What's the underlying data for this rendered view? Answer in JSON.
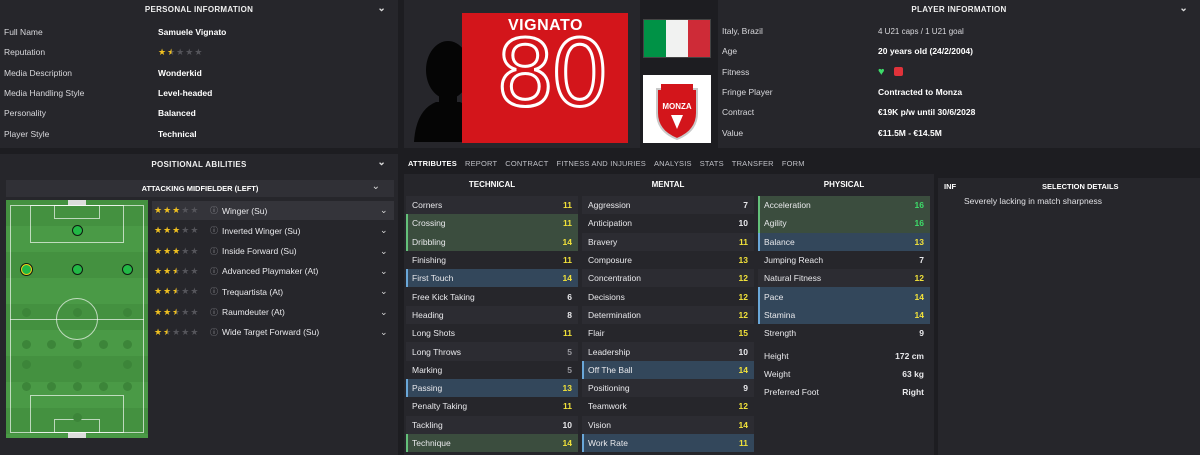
{
  "personal": {
    "title": "PERSONAL INFORMATION",
    "rows": [
      {
        "label": "Full Name",
        "value": "Samuele Vignato"
      },
      {
        "label": "Reputation",
        "value": ""
      },
      {
        "label": "Media Description",
        "value": "Wonderkid"
      },
      {
        "label": "Media Handling Style",
        "value": "Level-headed"
      },
      {
        "label": "Personality",
        "value": "Balanced"
      },
      {
        "label": "Player Style",
        "value": "Technical"
      }
    ],
    "reputation_stars": 1.5
  },
  "positional": {
    "title": "POSITIONAL ABILITIES",
    "sub_title": "ATTACKING MIDFIELDER (LEFT)",
    "roles": [
      {
        "name": "Winger (Su)",
        "stars": 3
      },
      {
        "name": "Inverted Winger (Su)",
        "stars": 3
      },
      {
        "name": "Inside Forward (Su)",
        "stars": 3
      },
      {
        "name": "Advanced Playmaker (At)",
        "stars": 2.5
      },
      {
        "name": "Trequartista (At)",
        "stars": 2.5
      },
      {
        "name": "Raumdeuter (At)",
        "stars": 2.5
      },
      {
        "name": "Wide Target Forward (Su)",
        "stars": 1.5
      }
    ]
  },
  "header": {
    "shirt_name": "VIGNATO",
    "shirt_number": "80",
    "club_badge": "MONZA"
  },
  "player_info": {
    "title": "PLAYER INFORMATION",
    "rows": [
      {
        "label": "Italy, Brazil",
        "value": "4 U21 caps / 1 U21 goal"
      },
      {
        "label": "Age",
        "value": "20 years old (24/2/2004)"
      },
      {
        "label": "Fitness",
        "value": ""
      },
      {
        "label": "Fringe Player",
        "value": "Contracted to Monza"
      },
      {
        "label": "Contract",
        "value": "€19K p/w until 30/6/2028"
      },
      {
        "label": "Value",
        "value": "€11.5M - €14.5M"
      }
    ]
  },
  "tabs": [
    "ATTRIBUTES",
    "REPORT",
    "CONTRACT",
    "FITNESS AND INJURIES",
    "ANALYSIS",
    "STATS",
    "TRANSFER",
    "FORM"
  ],
  "technical": {
    "title": "TECHNICAL",
    "rows": [
      {
        "name": "Corners",
        "value": "11"
      },
      {
        "name": "Crossing",
        "value": "11"
      },
      {
        "name": "Dribbling",
        "value": "14"
      },
      {
        "name": "Finishing",
        "value": "11"
      },
      {
        "name": "First Touch",
        "value": "14"
      },
      {
        "name": "Free Kick Taking",
        "value": "6"
      },
      {
        "name": "Heading",
        "value": "8"
      },
      {
        "name": "Long Shots",
        "value": "11"
      },
      {
        "name": "Long Throws",
        "value": "5"
      },
      {
        "name": "Marking",
        "value": "5"
      },
      {
        "name": "Passing",
        "value": "13"
      },
      {
        "name": "Penalty Taking",
        "value": "11"
      },
      {
        "name": "Tackling",
        "value": "10"
      },
      {
        "name": "Technique",
        "value": "14"
      }
    ]
  },
  "mental": {
    "title": "MENTAL",
    "rows": [
      {
        "name": "Aggression",
        "value": "7"
      },
      {
        "name": "Anticipation",
        "value": "10"
      },
      {
        "name": "Bravery",
        "value": "11"
      },
      {
        "name": "Composure",
        "value": "13"
      },
      {
        "name": "Concentration",
        "value": "12"
      },
      {
        "name": "Decisions",
        "value": "12"
      },
      {
        "name": "Determination",
        "value": "12"
      },
      {
        "name": "Flair",
        "value": "15"
      },
      {
        "name": "Leadership",
        "value": "10"
      },
      {
        "name": "Off The Ball",
        "value": "14"
      },
      {
        "name": "Positioning",
        "value": "9"
      },
      {
        "name": "Teamwork",
        "value": "12"
      },
      {
        "name": "Vision",
        "value": "14"
      },
      {
        "name": "Work Rate",
        "value": "11"
      }
    ]
  },
  "physical": {
    "title": "PHYSICAL",
    "rows": [
      {
        "name": "Acceleration",
        "value": "16"
      },
      {
        "name": "Agility",
        "value": "16"
      },
      {
        "name": "Balance",
        "value": "13"
      },
      {
        "name": "Jumping Reach",
        "value": "7"
      },
      {
        "name": "Natural Fitness",
        "value": "12"
      },
      {
        "name": "Pace",
        "value": "14"
      },
      {
        "name": "Stamina",
        "value": "14"
      },
      {
        "name": "Strength",
        "value": "9"
      }
    ],
    "extra": [
      {
        "name": "Height",
        "value": "172 cm"
      },
      {
        "name": "Weight",
        "value": "63 kg"
      },
      {
        "name": "Preferred Foot",
        "value": "Right"
      }
    ]
  },
  "selection": {
    "inf_label": "INF",
    "title": "SELECTION DETAILS",
    "text": "Severely lacking in match sharpness"
  },
  "colors": {
    "accent_red": "#d3151b",
    "star": "#f0c020",
    "green": "#3ddc6a",
    "yellow": "#f2e23a"
  }
}
